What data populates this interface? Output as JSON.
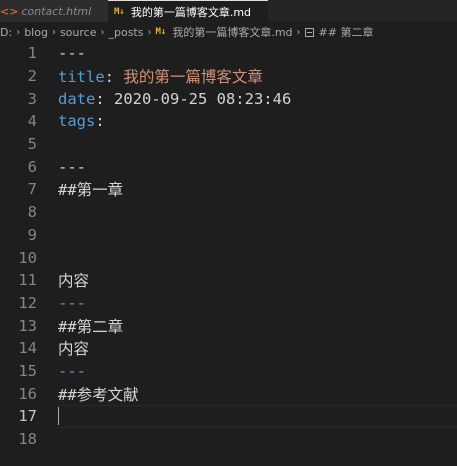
{
  "tabs": [
    {
      "label": "contact.html",
      "icon": "html-file-icon",
      "active": false
    },
    {
      "label": "我的第一篇博客文章.md",
      "icon": "markdown-file-icon",
      "active": true
    }
  ],
  "breadcrumb": {
    "drive": "D:",
    "folders": [
      "blog",
      "source",
      "_posts"
    ],
    "file": "我的第一篇博客文章.md",
    "symbol": "## 第二章"
  },
  "lines": [
    {
      "num": "1",
      "tokens": [
        {
          "t": "---",
          "c": "dash"
        }
      ]
    },
    {
      "num": "2",
      "tokens": [
        {
          "t": "title",
          "c": "key"
        },
        {
          "t": ": ",
          "c": "punc"
        },
        {
          "t": "我的第一篇博客文章",
          "c": "str"
        }
      ]
    },
    {
      "num": "3",
      "tokens": [
        {
          "t": "date",
          "c": "key"
        },
        {
          "t": ": 2020-09-25 08:23:46",
          "c": "text"
        }
      ]
    },
    {
      "num": "4",
      "tokens": [
        {
          "t": "tags",
          "c": "key"
        },
        {
          "t": ":",
          "c": "punc"
        }
      ]
    },
    {
      "num": "5",
      "tokens": []
    },
    {
      "num": "6",
      "tokens": [
        {
          "t": "---",
          "c": "dash"
        }
      ]
    },
    {
      "num": "7",
      "tokens": [
        {
          "t": "##第一章",
          "c": "text"
        }
      ]
    },
    {
      "num": "8",
      "tokens": []
    },
    {
      "num": "9",
      "tokens": []
    },
    {
      "num": "10",
      "tokens": []
    },
    {
      "num": "11",
      "tokens": [
        {
          "t": "内容",
          "c": "text"
        }
      ]
    },
    {
      "num": "12",
      "tokens": [
        {
          "t": "---",
          "c": "hr"
        }
      ]
    },
    {
      "num": "13",
      "tokens": [
        {
          "t": "##第二章",
          "c": "text"
        }
      ]
    },
    {
      "num": "14",
      "tokens": [
        {
          "t": "内容",
          "c": "text"
        }
      ]
    },
    {
      "num": "15",
      "tokens": [
        {
          "t": "---",
          "c": "hr"
        }
      ]
    },
    {
      "num": "16",
      "tokens": [
        {
          "t": "##参考文献",
          "c": "text"
        }
      ]
    },
    {
      "num": "17",
      "tokens": [],
      "current": true
    },
    {
      "num": "18",
      "tokens": []
    }
  ],
  "colors": {
    "key": "#569cd6",
    "string": "#ce9178",
    "text": "#d4d4d4",
    "markdown_icon": "#e6b422",
    "html_icon": "#e37933"
  }
}
